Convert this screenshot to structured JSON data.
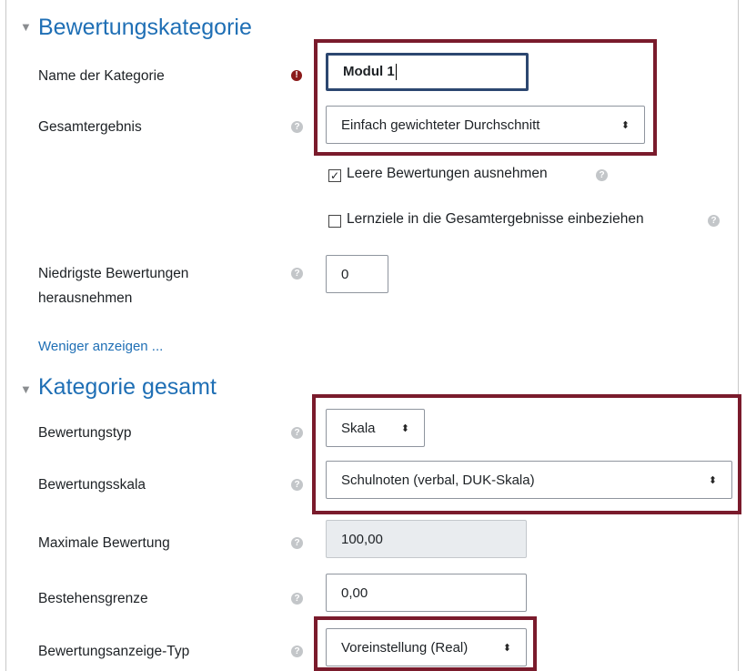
{
  "section1": {
    "title": "Bewertungskategorie",
    "name_label": "Name der Kategorie",
    "name_value": "Modul 1",
    "gesamt_label": "Gesamtergebnis",
    "gesamt_value": "Einfach gewichteter Durchschnitt",
    "checkbox1_label": "Leere Bewertungen ausnehmen",
    "checkbox1_checked": true,
    "checkbox2_label": "Lernziele in die Gesamtergebnisse einbeziehen",
    "checkbox2_checked": false,
    "drop_label_line1": "Niedrigste Bewertungen",
    "drop_label_line2": "herausnehmen",
    "drop_value": "0",
    "less_link": "Weniger anzeigen ..."
  },
  "section2": {
    "title": "Kategorie gesamt",
    "typ_label": "Bewertungstyp",
    "typ_value": "Skala",
    "skala_label": "Bewertungsskala",
    "skala_value": "Schulnoten (verbal, DUK-Skala)",
    "max_label": "Maximale Bewertung",
    "max_value": "100,00",
    "pass_label": "Bestehensgrenze",
    "pass_value": "0,00",
    "anzeige_label": "Bewertungsanzeige-Typ",
    "anzeige_value": "Voreinstellung (Real)"
  },
  "icons": {
    "help": "?",
    "required": "!",
    "section_caret": "▼",
    "select_arrows": "⬍",
    "checkmark": "✓"
  },
  "colors": {
    "accent": "#1f6fb5",
    "highlight": "#7a1b2c",
    "required": "#8b1a1a"
  }
}
